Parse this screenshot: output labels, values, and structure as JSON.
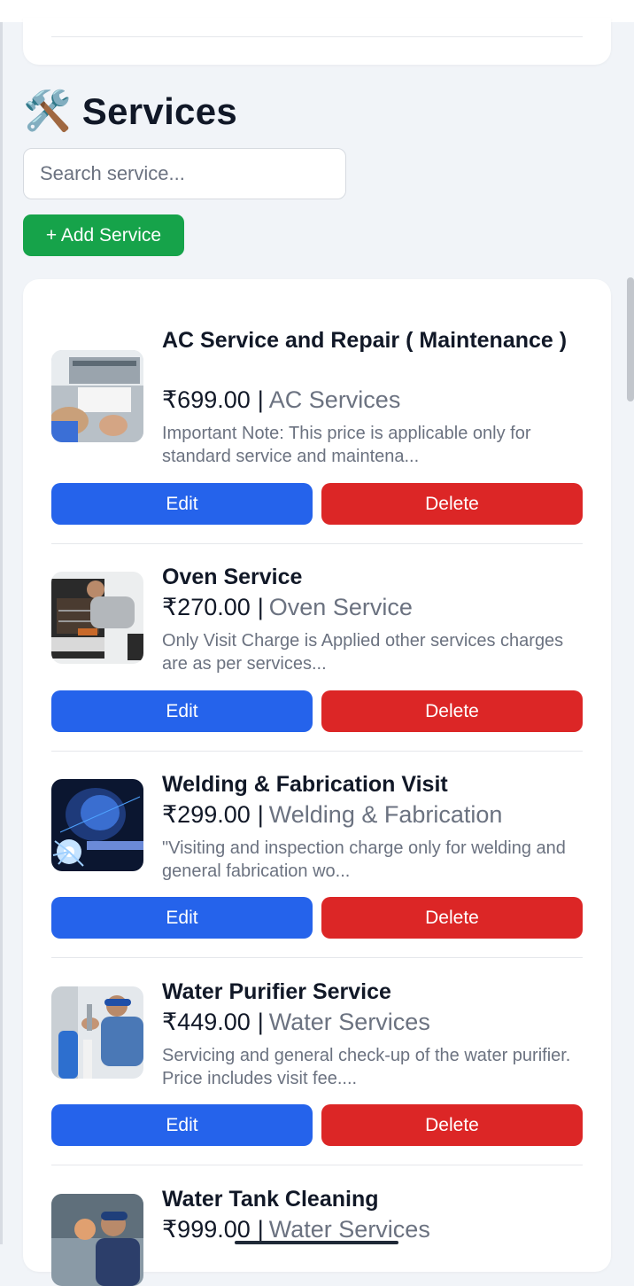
{
  "header": {
    "emoji": "🛠️",
    "title": "Services"
  },
  "search": {
    "placeholder": "Search service..."
  },
  "add_button": {
    "label": "+ Add Service"
  },
  "services": [
    {
      "name": "AC Service and Repair ( Maintenance )",
      "price": "₹699.00",
      "separator": "|",
      "category": "AC Services",
      "description": "Important Note: This price is applicable only for standard service and maintena...",
      "edit_label": "Edit",
      "delete_label": "Delete",
      "thumb_icon": "ac-repair-photo"
    },
    {
      "name": "Oven Service",
      "price": "₹270.00",
      "separator": "|",
      "category": "Oven Service",
      "description": "Only Visit Charge is Applied other services charges are as per services...",
      "edit_label": "Edit",
      "delete_label": "Delete",
      "thumb_icon": "oven-repair-photo"
    },
    {
      "name": "Welding & Fabrication Visit",
      "price": "₹299.00",
      "separator": "|",
      "category": "Welding & Fabrication",
      "description": "\"Visiting and inspection charge only for welding and general fabrication wo...",
      "edit_label": "Edit",
      "delete_label": "Delete",
      "thumb_icon": "welding-photo"
    },
    {
      "name": "Water Purifier Service",
      "price": "₹449.00",
      "separator": "|",
      "category": "Water Services",
      "description": "Servicing and general check-up of the water purifier. Price includes visit fee....",
      "edit_label": "Edit",
      "delete_label": "Delete",
      "thumb_icon": "water-purifier-photo"
    },
    {
      "name": "Water Tank Cleaning",
      "price": "₹999.00",
      "separator": "|",
      "category": "Water Services",
      "thumb_icon": "water-tank-photo"
    }
  ],
  "colors": {
    "add": "#16a34a",
    "edit": "#2563eb",
    "delete": "#dc2626",
    "category_text": "#6b7280"
  }
}
